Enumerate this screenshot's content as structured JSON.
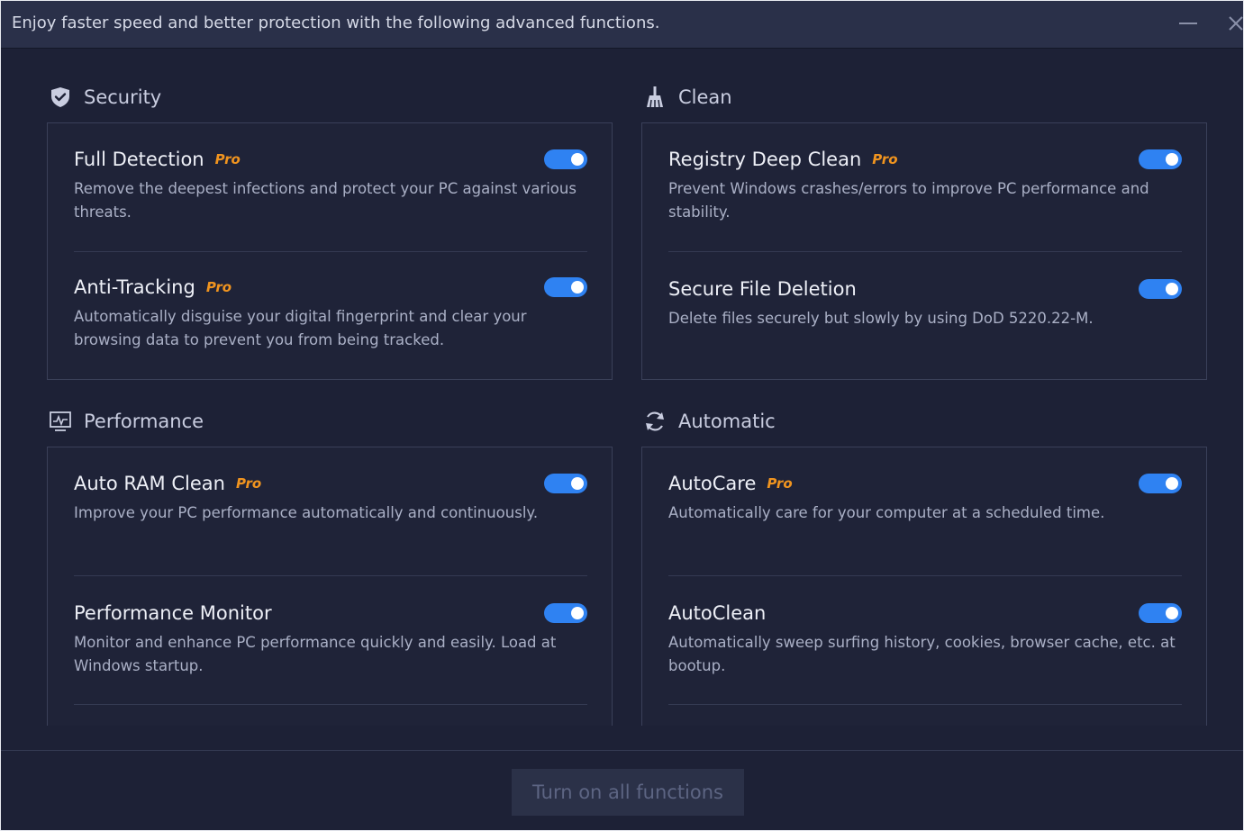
{
  "window": {
    "title": "Enjoy faster speed and better protection with the following advanced functions.",
    "minimize_icon": "minimize-icon",
    "close_icon": "close-icon"
  },
  "sections": {
    "security": {
      "title": "Security",
      "icon": "shield-icon",
      "items": [
        {
          "name": "Full Detection",
          "pro": "Pro",
          "desc": "Remove the deepest infections and protect your PC against various threats.",
          "enabled": true
        },
        {
          "name": "Anti-Tracking",
          "pro": "Pro",
          "desc": "Automatically disguise your digital fingerprint and clear your browsing data to prevent you from being tracked.",
          "enabled": true
        }
      ]
    },
    "clean": {
      "title": "Clean",
      "icon": "broom-icon",
      "items": [
        {
          "name": "Registry Deep Clean",
          "pro": "Pro",
          "desc": "Prevent Windows crashes/errors to improve PC performance and stability.",
          "enabled": true
        },
        {
          "name": "Secure File Deletion",
          "desc": "Delete files securely but slowly by using DoD 5220.22-M.",
          "enabled": true
        }
      ]
    },
    "performance": {
      "title": "Performance",
      "icon": "monitor-chart-icon",
      "items": [
        {
          "name": "Auto RAM Clean",
          "pro": "Pro",
          "desc": "Improve your PC performance automatically and continuously.",
          "enabled": true
        },
        {
          "name": "Performance Monitor",
          "desc": "Monitor and enhance PC performance quickly and easily. Load at Windows startup.",
          "enabled": true
        }
      ]
    },
    "automatic": {
      "title": "Automatic",
      "icon": "refresh-icon",
      "items": [
        {
          "name": "AutoCare",
          "pro": "Pro",
          "desc": "Automatically care for your computer at a scheduled time.",
          "enabled": true
        },
        {
          "name": "AutoClean",
          "desc": "Automatically sweep surfing history, cookies, browser cache, etc. at bootup.",
          "enabled": true
        }
      ]
    }
  },
  "footer": {
    "turn_on_label": "Turn on all functions"
  },
  "colors": {
    "background": "#1d2136",
    "accent_toggle": "#2f82f2",
    "pro_badge": "#f0941f"
  }
}
